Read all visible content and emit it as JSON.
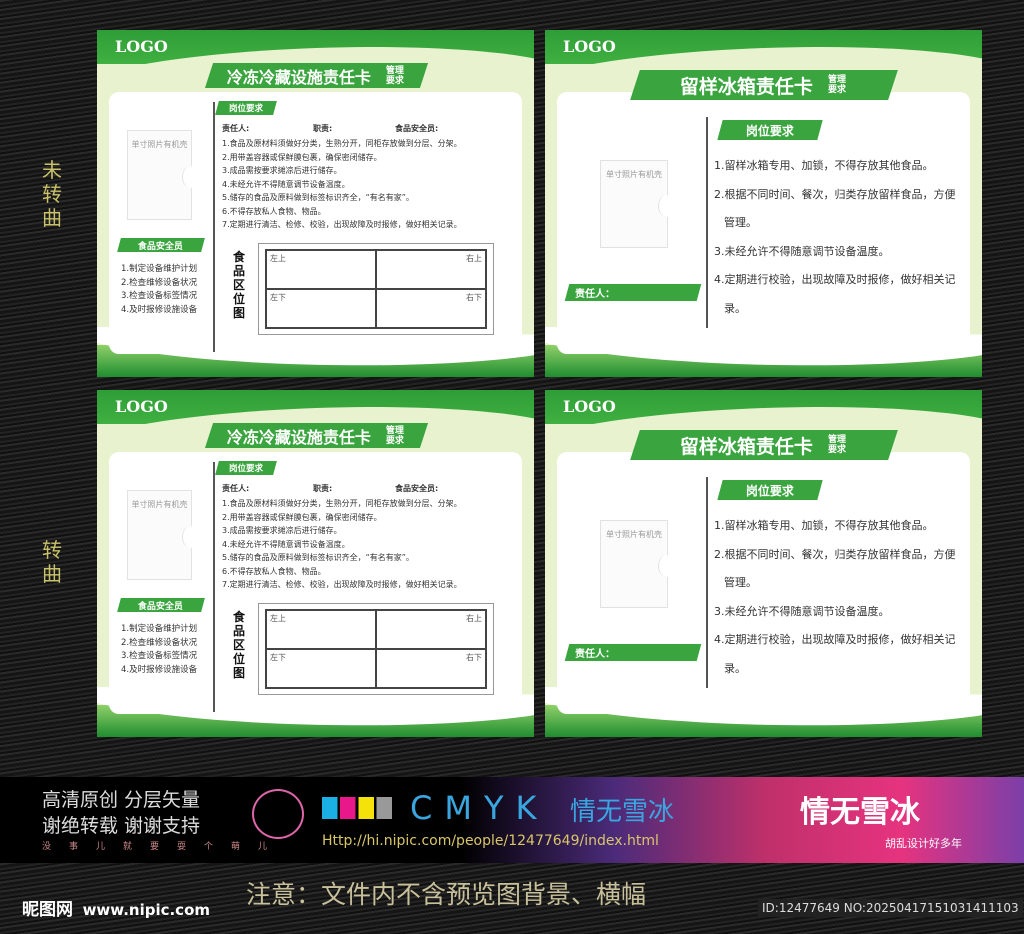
{
  "side_labels": {
    "unconverted": "未转曲",
    "converted": "转曲"
  },
  "card_a": {
    "logo": "LOGO",
    "title": "冷冻冷藏设施责任卡",
    "subtitle": "管理要求",
    "photo": "单寸照片有机壳",
    "duty_tag": "岗位要求",
    "resp": "责任人:",
    "duty": "职责:",
    "safety": "食品安全员:",
    "items": [
      "1.食品及原材料须做好分类，生熟分开，同柜存放做到分层、分架。",
      "2.用带盖容器或保鲜膜包裹，确保密闭储存。",
      "3.成品需按要求摊凉后进行储存。",
      "4.未经允许不得随意调节设备温度。",
      "5.储存的食品及原料做到标签标识齐全，“有名有家”。",
      "6.不得存放私人食物、物品。",
      "7.定期进行清洁、检修、校验，出现故障及时报修，做好相关记录。"
    ],
    "officer_tag": "食品安全员",
    "officer_items": [
      "1.制定设备维护计划",
      "2.检查维修设备状况",
      "3.检查设备标签情况",
      "4.及时报修设施设备"
    ],
    "map_label": "食品区位图",
    "cells": [
      "左上",
      "右上",
      "左下",
      "右下"
    ]
  },
  "card_b": {
    "logo": "LOGO",
    "title": "留样冰箱责任卡",
    "subtitle": "管理要求",
    "photo": "单寸照片有机壳",
    "duty_tag": "岗位要求",
    "resp": "责任人：",
    "items": [
      "1.留样冰箱专用、加锁，不得存放其他食品。",
      "2.根据不同时间、餐次，归类存放留样食品，方便管理。",
      "3.未经允许不得随意调节设备温度。",
      "4.定期进行校验，出现故障及时报修，做好相关记录。"
    ]
  },
  "banner": {
    "line1": "高清原创 分层矢量",
    "line2": "谢绝转载 谢谢支持",
    "slogan": "没事儿就要耍个萌儿",
    "cmyk": "CMYK",
    "author": "情无雪冰",
    "url": "Http://hi.nipic.com/people/12477649/index.html",
    "brand": "情无雪冰",
    "brand_sub": "胡乱设计好多年"
  },
  "notice": "注意：文件内不含预览图背景、横幅",
  "site": {
    "name": "昵图网",
    "url": "www.nipic.com"
  },
  "id_text": "ID:12477649 NO:20250417151031411103"
}
